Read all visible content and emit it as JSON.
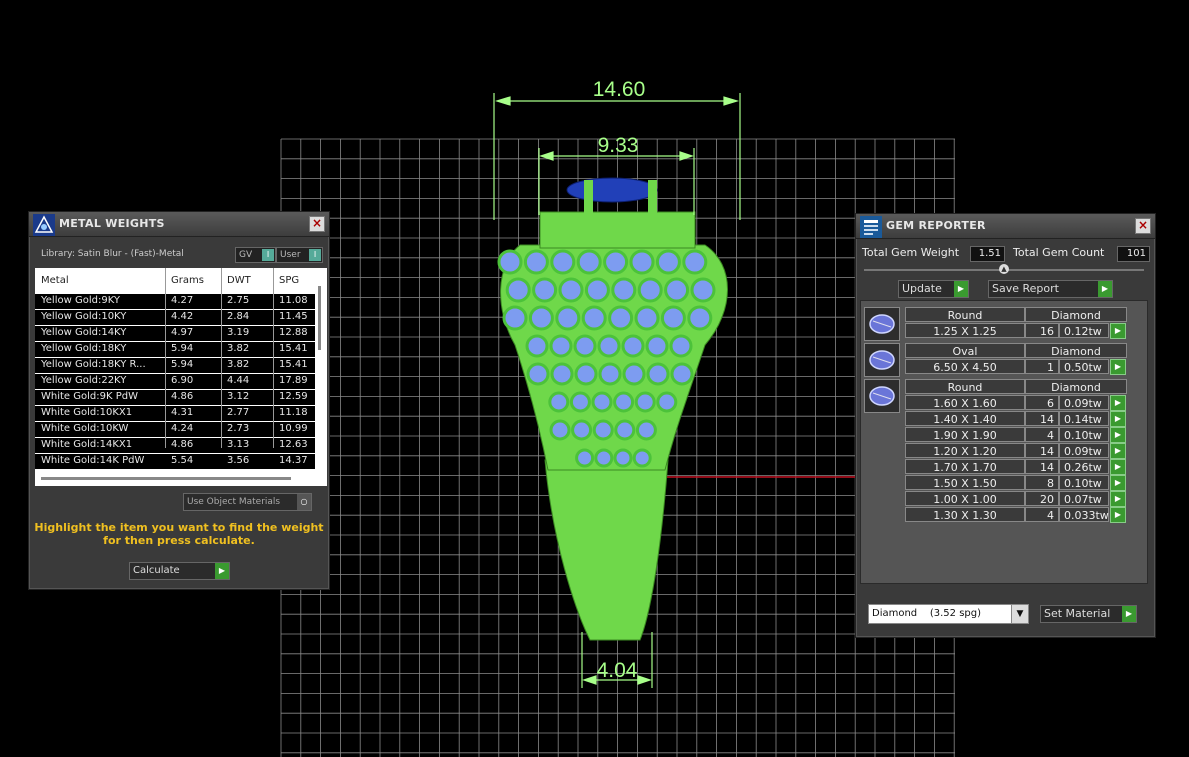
{
  "viewport": {
    "dimensions": {
      "top_width": "14.60",
      "inner_width": "9.33",
      "shank_width": "4.04"
    },
    "colors": {
      "grid": "#8a8a8a",
      "dimension": "#a8ff8a",
      "ring": "#7fe64f",
      "gem": "#7d9cf0",
      "axis": "#c01020"
    }
  },
  "metal_weights": {
    "title": "METAL WEIGHTS",
    "library": "Library: Satin Blur - (Fast)-Metal",
    "gv_label": "GV",
    "user_label": "User",
    "headers": [
      "Metal",
      "Grams",
      "DWT",
      "SPG"
    ],
    "rows": [
      [
        "Yellow Gold:9KY",
        "4.27",
        "2.75",
        "11.08"
      ],
      [
        "Yellow Gold:10KY",
        "4.42",
        "2.84",
        "11.45"
      ],
      [
        "Yellow Gold:14KY",
        "4.97",
        "3.19",
        "12.88"
      ],
      [
        "Yellow Gold:18KY",
        "5.94",
        "3.82",
        "15.41"
      ],
      [
        "Yellow Gold:18KY R...",
        "5.94",
        "3.82",
        "15.41"
      ],
      [
        "Yellow Gold:22KY",
        "6.90",
        "4.44",
        "17.89"
      ],
      [
        "White Gold:9K PdW",
        "4.86",
        "3.12",
        "12.59"
      ],
      [
        "White Gold:10KX1",
        "4.31",
        "2.77",
        "11.18"
      ],
      [
        "White Gold:10KW",
        "4.24",
        "2.73",
        "10.99"
      ],
      [
        "White Gold:14KX1",
        "4.86",
        "3.13",
        "12.63"
      ],
      [
        "White Gold:14K PdW",
        "5.54",
        "3.56",
        "14.37"
      ]
    ],
    "use_object_materials": "Use Object Materials",
    "hint_line1": "Highlight the item you want to find the weight",
    "hint_line2": "for then press calculate.",
    "calculate_label": "Calculate"
  },
  "gem_reporter": {
    "title": "GEM REPORTER",
    "total_weight_label": "Total Gem Weight",
    "total_weight": "1.51",
    "total_count_label": "Total Gem Count",
    "total_count": "101",
    "update_label": "Update",
    "save_label": "Save Report",
    "groups": [
      {
        "shape": "Round",
        "material": "Diamond",
        "items": [
          {
            "size": "1.25 X 1.25",
            "count": "16",
            "tw": "0.12tw"
          }
        ]
      },
      {
        "shape": "Oval",
        "material": "Diamond",
        "items": [
          {
            "size": "6.50 X 4.50",
            "count": "1",
            "tw": "0.50tw"
          }
        ]
      },
      {
        "shape": "Round",
        "material": "Diamond",
        "items": [
          {
            "size": "1.60 X 1.60",
            "count": "6",
            "tw": "0.09tw"
          },
          {
            "size": "1.40 X 1.40",
            "count": "14",
            "tw": "0.14tw"
          },
          {
            "size": "1.90 X 1.90",
            "count": "4",
            "tw": "0.10tw"
          },
          {
            "size": "1.20 X 1.20",
            "count": "14",
            "tw": "0.09tw"
          },
          {
            "size": "1.70 X 1.70",
            "count": "14",
            "tw": "0.26tw"
          },
          {
            "size": "1.50 X 1.50",
            "count": "8",
            "tw": "0.10tw"
          },
          {
            "size": "1.00 X 1.00",
            "count": "20",
            "tw": "0.07tw"
          },
          {
            "size": "1.30 X 1.30",
            "count": "4",
            "tw": "0.033tw"
          }
        ]
      }
    ],
    "material_select": "Diamond    (3.52 spg)",
    "set_material_label": "Set Material"
  }
}
